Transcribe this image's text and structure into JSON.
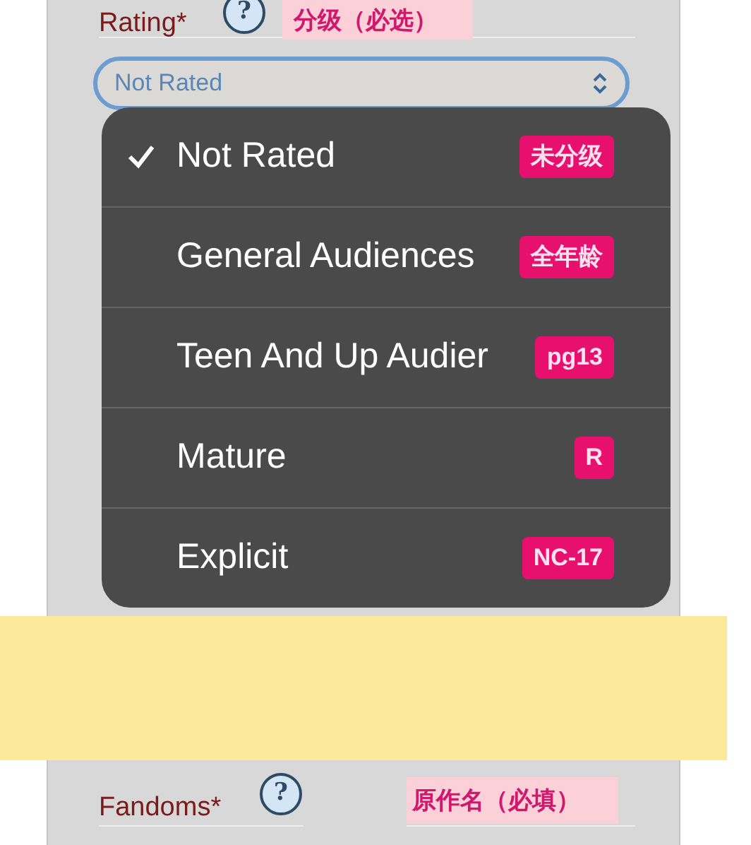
{
  "rating_field": {
    "label": "Rating*",
    "help": "?",
    "note": "分级（必选）",
    "value": "Not Rated"
  },
  "rating_menu": [
    {
      "label": "Not Rated",
      "selected": true,
      "note": "未分级"
    },
    {
      "label": "General Audiences",
      "selected": false,
      "note": "全年龄"
    },
    {
      "label": "Teen And Up Audier",
      "selected": false,
      "note": "pg13"
    },
    {
      "label": "Mature",
      "selected": false,
      "note": "R"
    },
    {
      "label": "Explicit",
      "selected": false,
      "note": "NC-17"
    }
  ],
  "fandoms_field": {
    "label": "Fandoms*",
    "help": "?",
    "note": "原作名（必填）"
  }
}
